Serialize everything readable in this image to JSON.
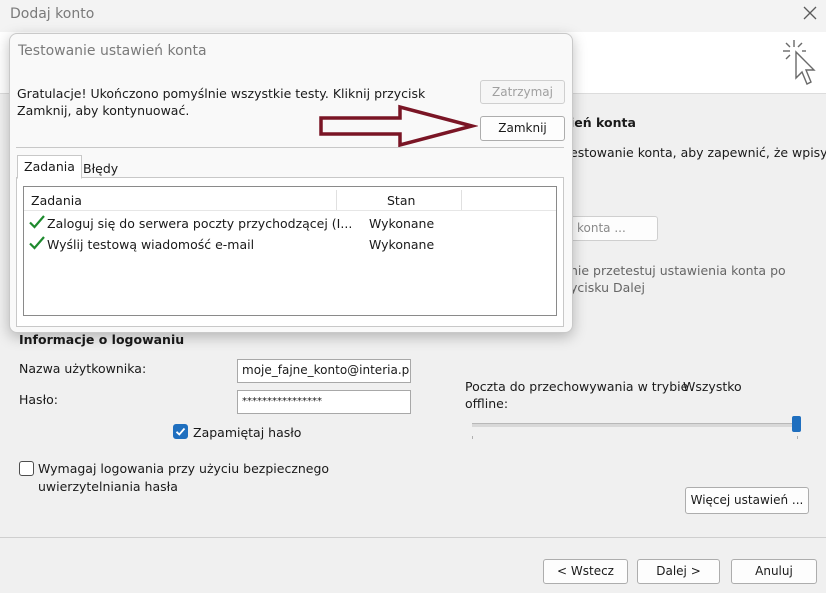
{
  "main_window": {
    "title": "Dodaj konto",
    "header_partial_label": "ień konta",
    "desc_partial_line1": "estowanie konta, aby zapewnić, że wpisy",
    "test_button_partial": "konta ...",
    "auto_test_partial_line1": "nie przetestuj ustawienia konta po",
    "auto_test_partial_line2": "ycisku Dalej",
    "login_section_title": "Informacje o logowaniu",
    "username_label": "Nazwa użytkownika:",
    "username_value": "moje_fajne_konto@interia.pl",
    "password_label": "Hasło:",
    "password_value": "****************",
    "remember_password_label": "Zapamiętaj hasło",
    "remember_password_checked": true,
    "spa_label_line1": "Wymagaj logowania przy użyciu bezpiecznego",
    "spa_label_line2": "uwierzytelniania hasła",
    "spa_checked": false,
    "offline_label_line1": "Poczta do przechowywania w trybie",
    "offline_label_line2": "offline:",
    "offline_value": "Wszystko",
    "offline_slider_fraction": 1.0,
    "more_settings_label": "Więcej ustawień ...",
    "back_label": "< Wstecz",
    "next_label": "Dalej >",
    "cancel_label": "Anuluj"
  },
  "dialog": {
    "title": "Testowanie ustawień konta",
    "message": "Gratulacje! Ukończono pomyślnie wszystkie testy. Kliknij przycisk Zamknij, aby kontynuować.",
    "stop_label": "Zatrzymaj",
    "close_label": "Zamknij",
    "tabs": [
      "Zadania",
      "Błędy"
    ],
    "columns": [
      "Zadania",
      "Stan"
    ],
    "tasks": [
      {
        "task": "Zaloguj się do serwera poczty przychodzącej (I...",
        "status": "Wykonane"
      },
      {
        "task": "Wyślij testową wiadomość e-mail",
        "status": "Wykonane"
      }
    ]
  },
  "colors": {
    "arrow": "#7a1525",
    "checkmark": "#1e8a2e",
    "accent": "#1f6fbf"
  }
}
